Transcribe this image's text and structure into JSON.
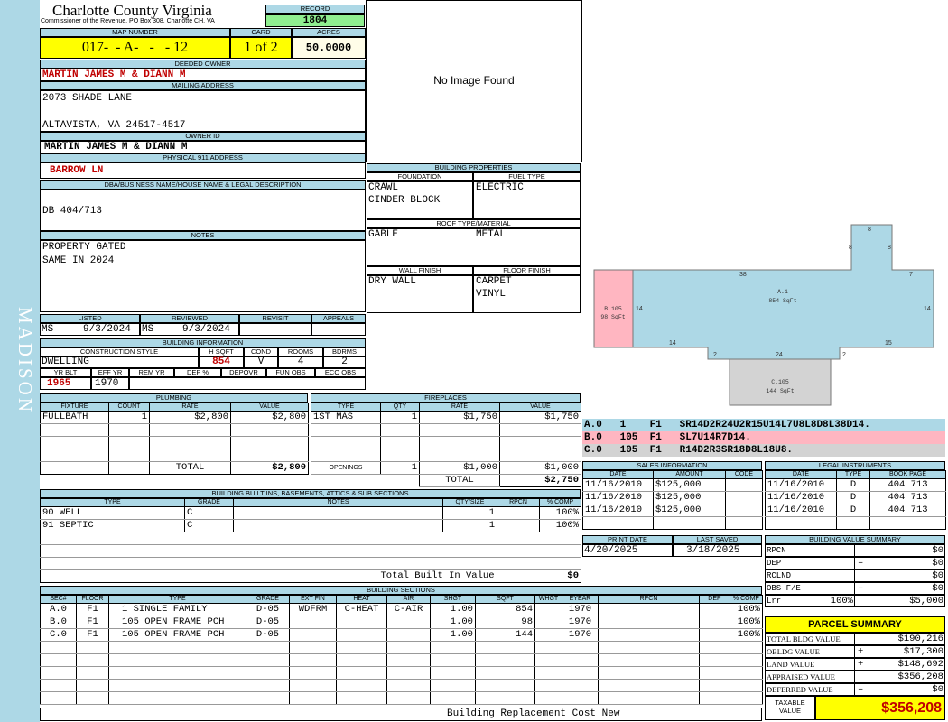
{
  "county": {
    "title": "Charlotte County Virginia",
    "subtitle": "Commissioner of the Revenue, PO Box 308, Charlotte CH, VA"
  },
  "side_label": "MADISON",
  "record": {
    "label": "RECORD",
    "value": "1804"
  },
  "map": {
    "label": "MAP NUMBER",
    "value": "017-  - A-   -   - 12"
  },
  "card": {
    "label": "CARD",
    "value": "1 of 2"
  },
  "acres": {
    "label": "ACRES",
    "value": "50.0000"
  },
  "deeded_owner": {
    "label": "DEEDED OWNER",
    "value": "MARTIN JAMES M & DIANN M"
  },
  "mailing": {
    "label": "MAILING ADDRESS",
    "line1": "2073 SHADE LANE",
    "line2": "ALTAVISTA, VA 24517-4517"
  },
  "owner_id": {
    "label": "OWNER ID",
    "value": "MARTIN JAMES M & DIANN M"
  },
  "physical": {
    "label": "PHYSICAL 911 ADDRESS",
    "value": "BARROW LN"
  },
  "dba": {
    "label": "DBA/BUSINESS NAME/HOUSE NAME & LEGAL DESCRIPTION",
    "value": "DB 404/713"
  },
  "notes": {
    "label": "NOTES",
    "line1": "PROPERTY GATED",
    "line2": "SAME IN 2024"
  },
  "photo": {
    "text": "No Image Found"
  },
  "building_properties": {
    "label": "BUILDING PROPERTIES",
    "foundation_label": "FOUNDATION",
    "fuel_label": "FUEL TYPE",
    "foundation1": "CRAWL",
    "foundation2": "CINDER BLOCK",
    "fuel": "ELECTRIC",
    "roof_label": "ROOF TYPE/MATERIAL",
    "roof_type": "GABLE",
    "roof_material": "METAL",
    "wall_label": "WALL FINISH",
    "floor_label": "FLOOR FINISH",
    "wall": "DRY WALL",
    "floor1": "CARPET",
    "floor2": "VINYL"
  },
  "review": {
    "listed_label": "LISTED",
    "reviewed_label": "REVIEWED",
    "revisit_label": "REVISIT",
    "appeals_label": "APPEALS",
    "listed_by": "MS",
    "listed_date": "9/3/2024",
    "reviewed_by": "MS",
    "reviewed_date": "9/3/2024"
  },
  "building_info": {
    "label": "BUILDING INFORMATION",
    "style_label": "CONSTRUCTION STYLE",
    "hsqft_label": "H SQFT",
    "cond_label": "COND",
    "rooms_label": "ROOMS",
    "bdrms_label": "BDRMS",
    "style": "DWELLING",
    "hsqft": "854",
    "cond": "V",
    "rooms": "4",
    "bdrms": "2",
    "yrblt_label": "YR BLT",
    "effyr_label": "EFF YR",
    "remyr_label": "REM YR",
    "dep_label": "DEP %",
    "depovr_label": "DEPOVR",
    "funobs_label": "FUN OBS",
    "ecoobs_label": "ECO OBS",
    "yrblt": "1965",
    "effyr": "1970"
  },
  "plumbing": {
    "label": "PLUMBING",
    "headers": [
      "FIXTURE",
      "COUNT",
      "RATE",
      "VALUE"
    ],
    "rows": [
      [
        "FULLBATH",
        "1",
        "$2,800",
        "$2,800"
      ],
      [
        "",
        "",
        "",
        ""
      ],
      [
        "",
        "",
        "",
        ""
      ],
      [
        "",
        "",
        "",
        ""
      ]
    ],
    "total_label": "TOTAL",
    "total": "$2,800"
  },
  "fireplaces": {
    "label": "FIREPLACES",
    "headers": [
      "TYPE",
      "QTY",
      "RATE",
      "VALUE"
    ],
    "rows": [
      [
        "1ST MAS",
        "1",
        "$1,750",
        "$1,750"
      ],
      [
        "",
        "",
        "",
        ""
      ],
      [
        "",
        "",
        "",
        ""
      ],
      [
        "",
        "",
        "",
        ""
      ]
    ],
    "openings_label": "OPENINGS",
    "openings": [
      "1",
      "$1,000",
      "$1,000"
    ],
    "total_label": "TOTAL",
    "total": "$2,750"
  },
  "sketch": {
    "labels": [
      {
        "t": "8"
      },
      {
        "t": "8"
      },
      {
        "t": "8"
      },
      {
        "t": "38"
      },
      {
        "t": "7"
      },
      {
        "t": "14"
      },
      {
        "t": "14"
      },
      {
        "t": "14"
      },
      {
        "t": "15"
      },
      {
        "t": "2"
      },
      {
        "t": "24"
      },
      {
        "t": "2"
      }
    ],
    "a1": "A.1",
    "a1_area": "854 SqFt",
    "b": "B.105",
    "b_area": "98 SqFt",
    "c": "C.105",
    "c_area": "144 SqFt"
  },
  "sketch_legend": [
    "A.0   1    F1   SR14D2R24U2R15U14L7U8L8D8L38D14.",
    "B.0   105  F1   SL7U14R7D14.",
    "C.0   105  F1   R14D2R3SR18D8L18U8."
  ],
  "sales": {
    "label": "SALES INFORMATION",
    "headers": [
      "DATE",
      "AMOUNT",
      "CODE"
    ],
    "rows": [
      [
        "11/16/2010",
        "$125,000",
        ""
      ],
      [
        "11/16/2010",
        "$125,000",
        ""
      ],
      [
        "11/16/2010",
        "$125,000",
        ""
      ],
      [
        "",
        "",
        ""
      ]
    ]
  },
  "legal": {
    "label": "LEGAL INSTRUMENTS",
    "headers": [
      "DATE",
      "TYPE",
      "BOOK PAGE"
    ],
    "rows": [
      [
        "11/16/2010",
        "D",
        "404 713"
      ],
      [
        "11/16/2010",
        "D",
        "404 713"
      ],
      [
        "11/16/2010",
        "D",
        "404 713"
      ],
      [
        "",
        "",
        ""
      ]
    ]
  },
  "print": {
    "print_label": "PRINT DATE",
    "saved_label": "LAST SAVED",
    "print_date": "4/20/2025",
    "saved_date": "3/18/2025"
  },
  "bvs": {
    "label": "BUILDING VALUE SUMMARY",
    "rows": [
      {
        "l": "RPCN",
        "p": "",
        "s": "",
        "v": "$0"
      },
      {
        "l": "DEP",
        "p": "",
        "s": "–",
        "v": "$0"
      },
      {
        "l": "RCLND",
        "p": "",
        "s": "",
        "v": "$0"
      },
      {
        "l": "OBS F/E",
        "p": "",
        "s": "–",
        "v": "$0"
      },
      {
        "l": "Lrr",
        "p": "100%",
        "s": "",
        "v": "$5,000"
      }
    ]
  },
  "parcel": {
    "title": "PARCEL SUMMARY",
    "rows": [
      {
        "l": "TOTAL BLDG VALUE",
        "s": "",
        "v": "$190,216"
      },
      {
        "l": "OBLDG VALUE",
        "s": "+",
        "v": "$17,300"
      },
      {
        "l": "LAND VALUE",
        "s": "+",
        "v": "$148,692"
      },
      {
        "l": "APPRAISED VALUE",
        "s": "",
        "v": "$356,208"
      },
      {
        "l": "DEFERRED VALUE",
        "s": "–",
        "v": "$0"
      }
    ],
    "taxable_label": "TAXABLE VALUE",
    "taxable": "$356,208"
  },
  "builtins": {
    "label": "BUILDING BUILT INS, BASEMENTS, ATTICS & SUB SECTIONS",
    "headers": [
      "TYPE",
      "GRADE",
      "NOTES",
      "QTY/SIZE",
      "RPCN",
      "% COMP"
    ],
    "rows": [
      [
        "90 WELL",
        "C",
        "",
        "1",
        "",
        "100%"
      ],
      [
        "91 SEPTIC",
        "C",
        "",
        "1",
        "",
        "100%"
      ],
      [
        "",
        "",
        "",
        "",
        "",
        ""
      ],
      [
        "",
        "",
        "",
        "",
        "",
        ""
      ],
      [
        "",
        "",
        "",
        "",
        "",
        ""
      ]
    ],
    "total_label": "Total Built In Value",
    "total": "$0"
  },
  "sections": {
    "label": "BUILDING SECTIONS",
    "headers": [
      "SEC#",
      "FLOOR",
      "TYPE",
      "GRADE",
      "EXT FIN",
      "HEAT",
      "AIR",
      "SHGT",
      "SQFT",
      "WHGT",
      "EYEAR",
      "RPCN",
      "DEP",
      "% COMP"
    ],
    "rows": [
      [
        "A.0",
        "F1",
        "1 SINGLE FAMILY",
        "D-05",
        "WDFRM",
        "C-HEAT",
        "C-AIR",
        "1.00",
        "854",
        "",
        "1970",
        "",
        "",
        "100%"
      ],
      [
        "B.0",
        "F1",
        "105 OPEN FRAME PCH",
        "D-05",
        "",
        "",
        "",
        "1.00",
        "98",
        "",
        "1970",
        "",
        "",
        "100%"
      ],
      [
        "C.0",
        "F1",
        "105 OPEN FRAME PCH",
        "D-05",
        "",
        "",
        "",
        "1.00",
        "144",
        "",
        "1970",
        "",
        "",
        "100%"
      ],
      [
        "",
        "",
        "",
        "",
        "",
        "",
        "",
        "",
        "",
        "",
        "",
        "",
        "",
        ""
      ],
      [
        "",
        "",
        "",
        "",
        "",
        "",
        "",
        "",
        "",
        "",
        "",
        "",
        "",
        ""
      ],
      [
        "",
        "",
        "",
        "",
        "",
        "",
        "",
        "",
        "",
        "",
        "",
        "",
        "",
        ""
      ],
      [
        "",
        "",
        "",
        "",
        "",
        "",
        "",
        "",
        "",
        "",
        "",
        "",
        "",
        ""
      ],
      [
        "",
        "",
        "",
        "",
        "",
        "",
        "",
        "",
        "",
        "",
        "",
        "",
        "",
        ""
      ]
    ],
    "footer": "Building Replacement Cost New"
  }
}
